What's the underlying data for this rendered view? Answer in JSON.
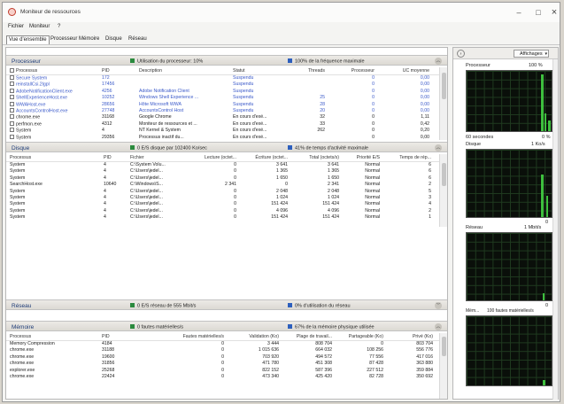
{
  "window": {
    "title": "Moniteur de ressources",
    "minimize": "–",
    "maximize": "□",
    "close": "×"
  },
  "menu": [
    "Fichier",
    "Moniteur",
    "?"
  ],
  "tabs": [
    "Vue d'ensemble",
    "Processeur",
    "Mémoire",
    "Disque",
    "Réseau"
  ],
  "cpu": {
    "title": "Processeur",
    "usage": "Utilisation du processeur: 10%",
    "freq": "100% de la fréquence maximale",
    "columns": [
      "Processus",
      "PID",
      "Description",
      "Statut",
      "Threads",
      "Processeur",
      "UC moyenne"
    ],
    "rows": [
      [
        "Secure System",
        "172",
        "",
        "Suspendu",
        "",
        "0",
        "0,00"
      ],
      [
        "reinstallCsi.2lgpl",
        "17456",
        "",
        "Suspendu",
        "",
        "0",
        "0,00"
      ],
      [
        "AdobeNotificationClient.exe",
        "4256",
        "Adobe Notification Client",
        "Suspendu",
        "",
        "0",
        "0,00"
      ],
      [
        "ShellExperienceHost.exe",
        "10252",
        "Windows Shell Experience ...",
        "Suspendu",
        "25",
        "0",
        "0,00"
      ],
      [
        "WWAHost.exe",
        "28656",
        "Hôte Microsoft WWA",
        "Suspendu",
        "28",
        "0",
        "0,00"
      ],
      [
        "AccountsControlHost.exe",
        "27748",
        "AccountsControl Host",
        "Suspendu",
        "20",
        "0",
        "0,00"
      ],
      [
        "chrome.exe",
        "31168",
        "Google Chrome",
        "En cours d'exé...",
        "32",
        "0",
        "1,11"
      ],
      [
        "perfmon.exe",
        "4312",
        "Moniteur de ressources et ...",
        "En cours d'exé...",
        "33",
        "0",
        "0,42"
      ],
      [
        "System",
        "4",
        "NT Kernel & System",
        "En cours d'exé...",
        "262",
        "0",
        "0,20"
      ],
      [
        "System",
        "29356",
        "Processus inactif du...",
        "En cours d'exé...",
        "",
        "0",
        "0,00"
      ]
    ]
  },
  "disk": {
    "title": "Disque",
    "io": "0 E/S disque par 102400 Ko/sec",
    "active": "41% de temps d'activité maximale",
    "columns": [
      "Processus",
      "PID",
      "Fichier",
      "Lecture (octet...",
      "Écriture (octet...",
      "Total (octets/s)",
      "Priorité E/S",
      "Temps de rép..."
    ],
    "rows": [
      [
        "System",
        "4",
        "C:\\System Volu...",
        "0",
        "3 641",
        "3 641",
        "Normal",
        "6"
      ],
      [
        "System",
        "4",
        "C:\\Users\\jedel...",
        "0",
        "1 365",
        "1 365",
        "Normal",
        "6"
      ],
      [
        "System",
        "4",
        "C:\\Users\\jedel...",
        "0",
        "1 650",
        "1 650",
        "Normal",
        "6"
      ],
      [
        "SearchHost.exe",
        "10640",
        "C:\\Windows\\S...",
        "2 341",
        "0",
        "2 341",
        "Normal",
        "2"
      ],
      [
        "System",
        "4",
        "C:\\Users\\jedel...",
        "0",
        "2 048",
        "2 048",
        "Normal",
        "5"
      ],
      [
        "System",
        "4",
        "C:\\Users\\jedel...",
        "0",
        "1 024",
        "1 024",
        "Normal",
        "3"
      ],
      [
        "System",
        "4",
        "C:\\Users\\jedel...",
        "0",
        "151 424",
        "151 424",
        "Normal",
        "4"
      ],
      [
        "System",
        "4",
        "C:\\Users\\jedel...",
        "0",
        "4 096",
        "4 096",
        "Normal",
        "2"
      ],
      [
        "System",
        "4",
        "C:\\Users\\jedel...",
        "0",
        "151 424",
        "151 424",
        "Normal",
        "1"
      ]
    ]
  },
  "network": {
    "title": "Réseau",
    "io": "0 E/S réseau de 555 Mbit/s",
    "usage": "0% d'utilisation du réseau"
  },
  "memory": {
    "title": "Mémoire",
    "faults": "0 fautes matérielles/s",
    "used": "67% de la mémoire physique utilisée",
    "columns": [
      "Processus",
      "PID",
      "Fautes matérielles/s",
      "Validation (Ko)",
      "Plage de travail...",
      "Partageable (Ko)",
      "Privé (Ko)"
    ],
    "rows": [
      [
        "Memory Compression",
        "4184",
        "0",
        "3 444",
        "808 704",
        "0",
        "803 704"
      ],
      [
        "chrome.exe",
        "31188",
        "0",
        "1 015 636",
        "664 032",
        "108 256",
        "556 776"
      ],
      [
        "chrome.exe",
        "19600",
        "0",
        "703 920",
        "494 572",
        "77 556",
        "417 016"
      ],
      [
        "chrome.exe",
        "31856",
        "0",
        "471 780",
        "451 308",
        "87 428",
        "363 880"
      ],
      [
        "explorer.exe",
        "25268",
        "0",
        "822 152",
        "587 396",
        "227 512",
        "359 884"
      ],
      [
        "chrome.exe",
        "22424",
        "0",
        "473 340",
        "425 420",
        "82 728",
        "350 692"
      ]
    ]
  },
  "side": {
    "views": "Affichages",
    "graphs": [
      {
        "label": "Processeur",
        "value": "100 %",
        "bottom_left": "60 secondes",
        "bottom_right": "0 %"
      },
      {
        "label": "Disque",
        "value": "1 Ko/s",
        "bottom_left": "",
        "bottom_right": "0"
      },
      {
        "label": "Réseau",
        "value": "1 Mbit/s",
        "bottom_left": "",
        "bottom_right": "0"
      },
      {
        "label": "Mém...",
        "value": "100 fautes matérielles/s",
        "bottom_left": "",
        "bottom_right": ""
      }
    ]
  }
}
